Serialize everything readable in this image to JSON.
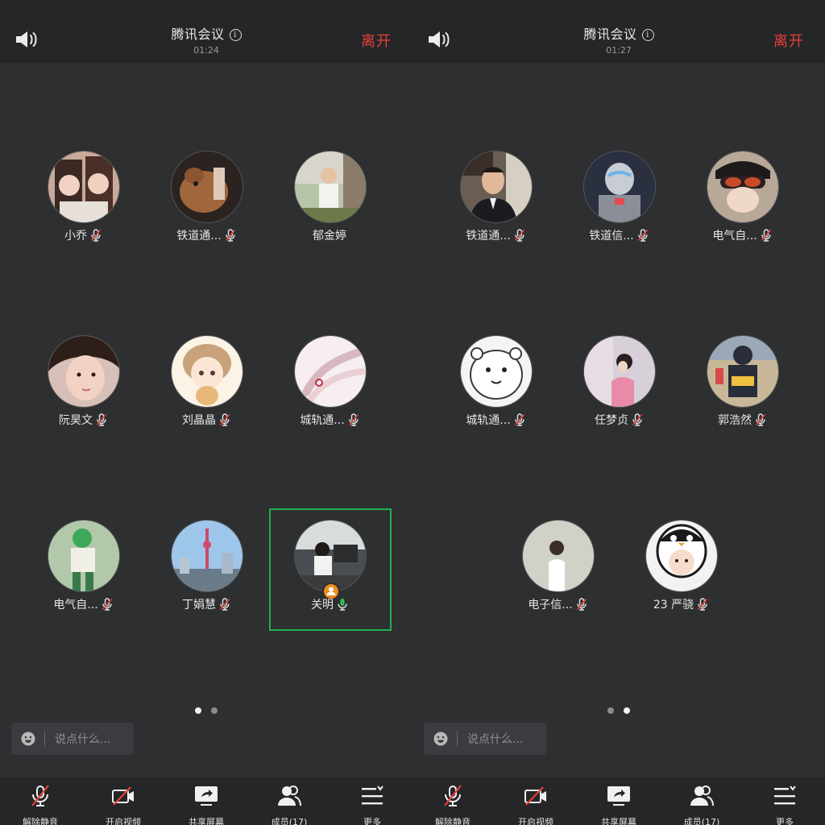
{
  "panels": [
    {
      "title": "腾讯会议",
      "timer": "01:24",
      "leave_label": "离开",
      "participants": [
        {
          "name": "小乔",
          "mic": "muted",
          "photo": "two girls"
        },
        {
          "name": "铁道通...",
          "mic": "muted",
          "photo": "dog"
        },
        {
          "name": "郁金婷",
          "mic": "none",
          "photo": "child"
        },
        {
          "name": "阮昊文",
          "mic": "muted",
          "photo": "woman face"
        },
        {
          "name": "刘晶晶",
          "mic": "muted",
          "photo": "anime girl"
        },
        {
          "name": "城轨通...",
          "mic": "muted",
          "photo": "hand drawing"
        },
        {
          "name": "电气自...",
          "mic": "muted",
          "photo": "anime boy"
        },
        {
          "name": "丁娟慧",
          "mic": "muted",
          "photo": "shanghai skyline"
        },
        {
          "name": "关明",
          "mic": "active",
          "photo": "child at desk",
          "host": true,
          "speaking": true
        }
      ],
      "page_dots": [
        true,
        false
      ],
      "chat_placeholder": "说点什么...",
      "toolbar": [
        {
          "label": "解除静音",
          "icon": "mic-muted-icon"
        },
        {
          "label": "开启视频",
          "icon": "video-off-icon"
        },
        {
          "label": "共享屏幕",
          "icon": "share-screen-icon"
        },
        {
          "label": "成员(17)",
          "icon": "members-icon"
        },
        {
          "label": "更多",
          "icon": "more-icon"
        }
      ]
    },
    {
      "title": "腾讯会议",
      "timer": "01:27",
      "leave_label": "离开",
      "participants": [
        {
          "name": "铁道通...",
          "mic": "muted",
          "photo": "man in suit"
        },
        {
          "name": "铁道信...",
          "mic": "muted",
          "photo": "ultraman"
        },
        {
          "name": "电气自...",
          "mic": "muted",
          "photo": "goggles"
        },
        {
          "name": "城轨通...",
          "mic": "muted",
          "photo": "hamster sketch"
        },
        {
          "name": "任梦贞",
          "mic": "muted",
          "photo": "girl in pink"
        },
        {
          "name": "郭浩然",
          "mic": "muted",
          "photo": "police figure"
        },
        {
          "name": "电子信...",
          "mic": "muted",
          "photo": "woman white dress"
        },
        {
          "name": "23 严骁",
          "mic": "muted",
          "photo": "baby penguin hat"
        }
      ],
      "page_dots": [
        false,
        true
      ],
      "chat_placeholder": "说点什么...",
      "toolbar": [
        {
          "label": "解除静音",
          "icon": "mic-muted-icon"
        },
        {
          "label": "开启视频",
          "icon": "video-off-icon"
        },
        {
          "label": "共享屏幕",
          "icon": "share-screen-icon"
        },
        {
          "label": "成员(17)",
          "icon": "members-icon"
        },
        {
          "label": "更多",
          "icon": "more-icon"
        }
      ]
    }
  ],
  "colors": {
    "background": "#2d2f31",
    "bar": "#242628",
    "leave": "#e8403a",
    "speaking_frame": "#1fb04a",
    "host_badge": "#f08a1c"
  }
}
